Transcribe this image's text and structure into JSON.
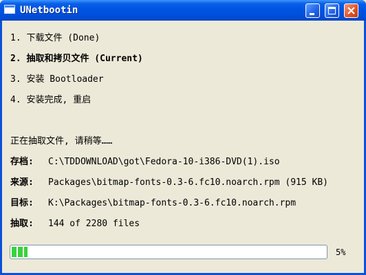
{
  "window": {
    "title": "UNetbootin"
  },
  "steps": [
    {
      "label": "1. 下载文件 (Done)"
    },
    {
      "label": "2. 抽取和拷贝文件 (Current)"
    },
    {
      "label": "3. 安装 Bootloader"
    },
    {
      "label": "4. 安装完成, 重启"
    }
  ],
  "status": {
    "message": "正在抽取文件, 请稍等……",
    "archive_label": "存档:",
    "archive_value": "C:\\TDDOWNLOAD\\got\\Fedora-10-i386-DVD(1).iso",
    "source_label": "来源:",
    "source_value": "Packages\\bitmap-fonts-0.3-6.fc10.noarch.rpm (915 KB)",
    "target_label": "目标:",
    "target_value": "K:\\Packages\\bitmap-fonts-0.3-6.fc10.noarch.rpm",
    "extract_label": "抽取:",
    "extract_value": "144 of 2280 files"
  },
  "progress": {
    "percent": 5,
    "percent_label": "5%",
    "color": "#37d43a"
  }
}
